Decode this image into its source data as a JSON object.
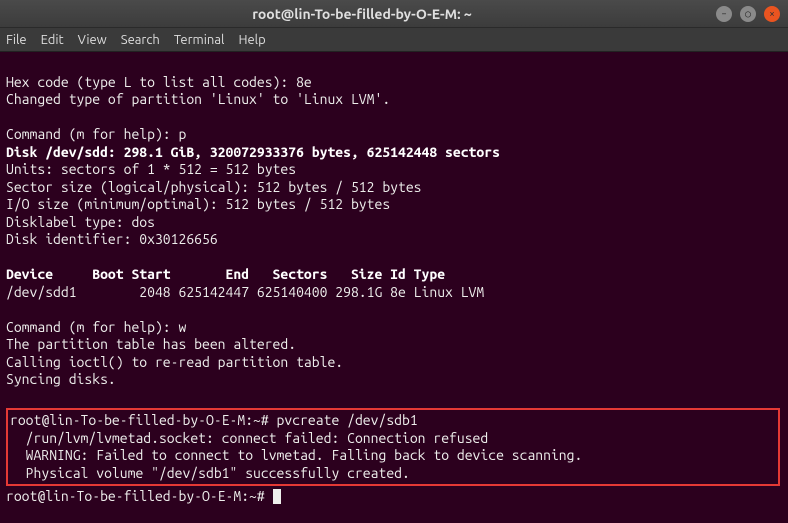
{
  "window": {
    "title": "root@lin-To-be-filled-by-O-E-M: ~"
  },
  "menubar": {
    "file": "File",
    "edit": "Edit",
    "view": "View",
    "search": "Search",
    "terminal": "Terminal",
    "help": "Help"
  },
  "terminal": {
    "l1": "Hex code (type L to list all codes): 8e",
    "l2": "Changed type of partition 'Linux' to 'Linux LVM'.",
    "l3": "",
    "l4": "Command (m for help): p",
    "l5": "Disk /dev/sdd: 298.1 GiB, 320072933376 bytes, 625142448 sectors",
    "l6": "Units: sectors of 1 * 512 = 512 bytes",
    "l7": "Sector size (logical/physical): 512 bytes / 512 bytes",
    "l8": "I/O size (minimum/optimal): 512 bytes / 512 bytes",
    "l9": "Disklabel type: dos",
    "l10": "Disk identifier: 0x30126656",
    "l11": "",
    "l12": "Device     Boot Start       End   Sectors   Size Id Type",
    "l13": "/dev/sdd1        2048 625142447 625140400 298.1G 8e Linux LVM",
    "l14": "",
    "l15": "Command (m for help): w",
    "l16": "The partition table has been altered.",
    "l17": "Calling ioctl() to re-read partition table.",
    "l18": "Syncing disks.",
    "l19": "",
    "h1": "root@lin-To-be-filled-by-O-E-M:~# pvcreate /dev/sdb1",
    "h2": "  /run/lvm/lvmetad.socket: connect failed: Connection refused",
    "h3": "  WARNING: Failed to connect to lvmetad. Falling back to device scanning.",
    "h4": "  Physical volume \"/dev/sdb1\" successfully created.",
    "prompt": "root@lin-To-be-filled-by-O-E-M:~# "
  }
}
